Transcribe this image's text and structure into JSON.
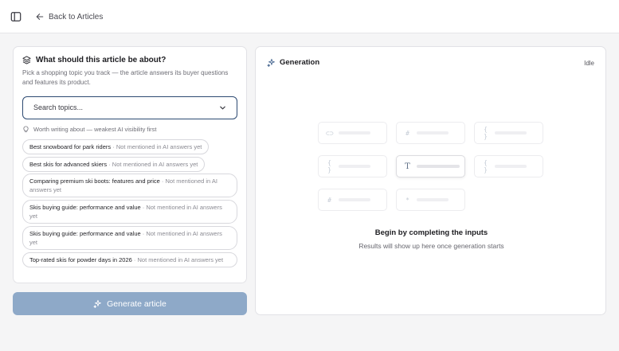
{
  "header": {
    "sidebar_toggle_icon": "panel-left-icon",
    "back_icon": "arrow-left-icon",
    "back_label": "Back to Articles"
  },
  "topic": {
    "icon": "layers-icon",
    "title": "What should this article be about?",
    "description": "Pick a shopping topic you track — the article answers its buyer questions and features its product.",
    "search_placeholder": "Search topics...",
    "hint_icon": "lightbulb-icon",
    "hint": "Worth writing about — weakest AI visibility first",
    "suggestions": [
      {
        "label": "Best snowboard for park riders",
        "meta": "· Not mentioned in AI answers yet"
      },
      {
        "label": "Best skis for advanced skiers",
        "meta": "· Not mentioned in AI answers yet"
      },
      {
        "label": "Comparing premium ski boots: features and price",
        "meta": "· Not mentioned in AI answers yet"
      },
      {
        "label": "Skis buying guide: performance and value",
        "meta": "· Not mentioned in AI answers yet"
      },
      {
        "label": "Skis buying guide: performance and value",
        "meta": "· Not mentioned in AI answers yet"
      },
      {
        "label": "Top-rated skis for powder days in 2026",
        "meta": "· Not mentioned in AI answers yet"
      }
    ]
  },
  "generate_button": {
    "icon": "sparkles-icon",
    "label": "Generate article"
  },
  "generation": {
    "icon": "sparkles-icon",
    "title": "Generation",
    "status": "Idle",
    "tiles": [
      {
        "glyph": "⊂⊃"
      },
      {
        "glyph": "#"
      },
      {
        "glyph": "{ }"
      },
      {
        "glyph": "{ }"
      },
      {
        "glyph": "T"
      },
      {
        "glyph": "{ }"
      },
      {
        "glyph": "#"
      },
      {
        "glyph": "*"
      }
    ],
    "empty_title": "Begin by completing the inputs",
    "empty_subtitle": "Results will show up here once generation starts"
  },
  "colors": {
    "accent": "#2d4a72",
    "button_disabled": "#8ea9c8",
    "sparkle": "#4b6a93"
  }
}
